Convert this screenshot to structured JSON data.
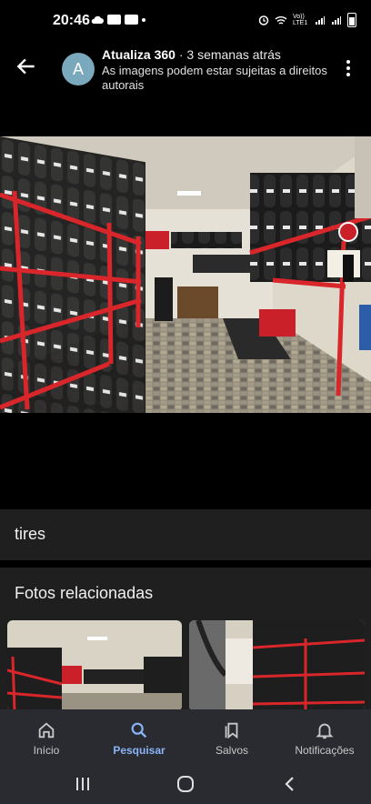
{
  "status": {
    "time": "20:46",
    "net": "Vo)) LTE1"
  },
  "header": {
    "avatar_letter": "A",
    "source": "Atualiza 360",
    "separator": "·",
    "age": "3 semanas atrás",
    "notice": "As imagens podem estar sujeitas a direitos autorais"
  },
  "image": {
    "description_icon": "tire-shop-photo"
  },
  "caption": "tires",
  "related": {
    "title": "Fotos relacionadas"
  },
  "nav": {
    "items": [
      {
        "label": "Início",
        "icon": "home-icon"
      },
      {
        "label": "Pesquisar",
        "icon": "search-icon"
      },
      {
        "label": "Salvos",
        "icon": "bookmarks-icon"
      },
      {
        "label": "Notificações",
        "icon": "bell-icon"
      }
    ],
    "active": "Pesquisar"
  },
  "colors": {
    "accent": "#8ab4f8",
    "navbar": "#2a2b30",
    "panel": "#1f1f1f",
    "rack": "#d8262b"
  }
}
